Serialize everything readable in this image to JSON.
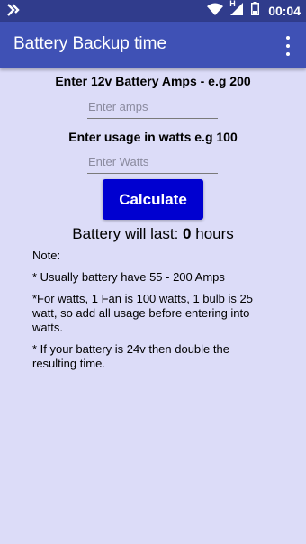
{
  "status_bar": {
    "time": "00:04",
    "icons": [
      "notification-icon",
      "wifi-icon",
      "signal-icon",
      "battery-icon"
    ],
    "network_type": "H"
  },
  "app_bar": {
    "title": "Battery Backup time",
    "menu_icon": "overflow-menu-icon"
  },
  "form": {
    "amps_label": "Enter 12v Battery Amps - e.g 200",
    "amps_placeholder": "Enter amps",
    "amps_value": "",
    "watts_label": "Enter usage in watts e.g 100",
    "watts_placeholder": "Enter Watts",
    "watts_value": "",
    "calculate_label": "Calculate"
  },
  "result": {
    "prefix": "Battery will last: ",
    "value": "0",
    "suffix": " hours"
  },
  "notes": {
    "heading": "Note:",
    "items": [
      "* Usually battery have 55 - 200 Amps",
      "*For watts, 1 Fan is 100 watts, 1 bulb is 25 watt, so add all usage before entering into watts.",
      "* If your battery is 24v then double the resulting time."
    ]
  },
  "colors": {
    "status_bar": "#303c8c",
    "app_bar": "#3f51b5",
    "background": "#dcdcf8",
    "button": "#0000d0"
  }
}
